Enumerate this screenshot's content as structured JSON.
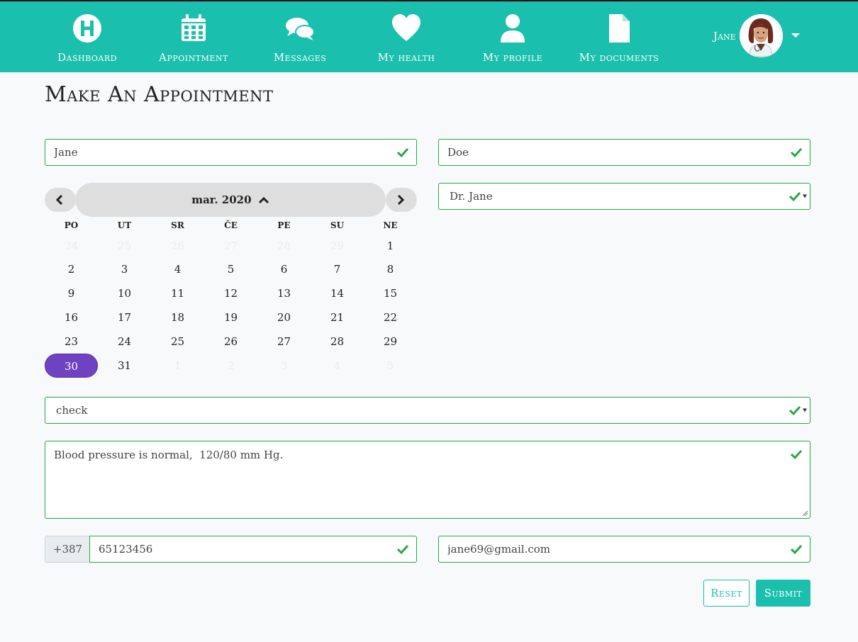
{
  "nav": {
    "items": [
      {
        "label": "Dashboard",
        "icon": "hospital-h-icon"
      },
      {
        "label": "Appointment",
        "icon": "calendar-icon"
      },
      {
        "label": "Messages",
        "icon": "chat-bubbles-icon"
      },
      {
        "label": "My health",
        "icon": "heart-icon"
      },
      {
        "label": "My profile",
        "icon": "user-icon"
      },
      {
        "label": "My documents",
        "icon": "document-icon"
      }
    ],
    "user": {
      "name": "Jane",
      "avatar": "doctor-avatar"
    }
  },
  "page": {
    "title": "Make An Appointment"
  },
  "form": {
    "first_name": "Jane",
    "last_name": "Doe",
    "doctor": "Dr. Jane",
    "reason": "check",
    "notes": "Blood pressure is normal,  120/80 mm Hg.",
    "phone_prefix": "+387",
    "phone": "65123456",
    "email": "jane69@gmail.com",
    "reset_label": "Reset",
    "submit_label": "Submit"
  },
  "calendar": {
    "month_label": "mar. 2020",
    "weekdays": [
      "PO",
      "UT",
      "SR",
      "ČE",
      "PE",
      "SU",
      "NE"
    ],
    "weeks": [
      [
        "24",
        "25",
        "26",
        "27",
        "28",
        "29",
        "1"
      ],
      [
        "2",
        "3",
        "4",
        "5",
        "6",
        "7",
        "8"
      ],
      [
        "9",
        "10",
        "11",
        "12",
        "13",
        "14",
        "15"
      ],
      [
        "16",
        "17",
        "18",
        "19",
        "20",
        "21",
        "22"
      ],
      [
        "23",
        "24",
        "25",
        "26",
        "27",
        "28",
        "29"
      ],
      [
        "30",
        "31",
        "1",
        "2",
        "3",
        "4",
        "5"
      ]
    ],
    "muted_before": 6,
    "muted_after": 5,
    "selected": "30",
    "selected_color": "#6f42c1"
  },
  "colors": {
    "primary": "#1bbfad",
    "valid": "#28a745"
  }
}
